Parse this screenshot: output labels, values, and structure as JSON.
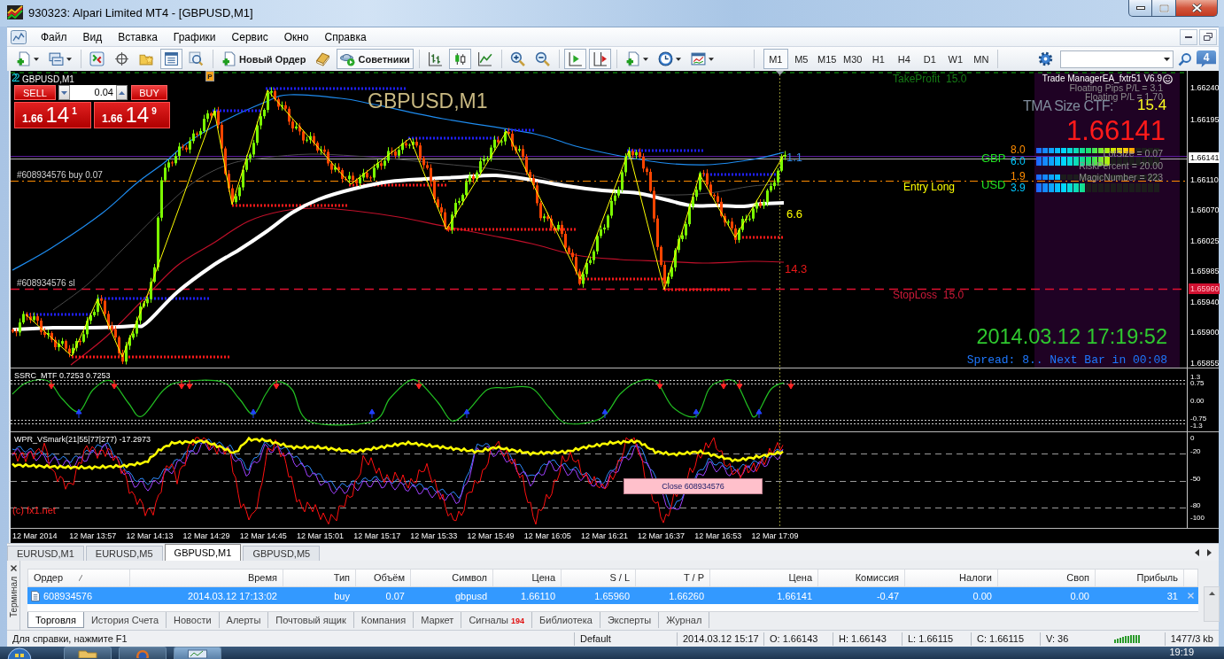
{
  "window": {
    "title": "930323: Alpari Limited MT4 - [GBPUSD,M1]"
  },
  "menu": [
    "Файл",
    "Вид",
    "Вставка",
    "Графики",
    "Сервис",
    "Окно",
    "Справка"
  ],
  "toolbar": {
    "groups": [
      [
        {
          "kind": "new-chart",
          "on": false
        },
        {
          "kind": "profiles",
          "on": false
        }
      ],
      [
        {
          "kind": "market-watch",
          "on": false
        },
        {
          "kind": "data-window",
          "on": false
        },
        {
          "kind": "navigator",
          "on": false
        },
        {
          "kind": "terminal",
          "on": true
        },
        {
          "kind": "tester",
          "on": false
        }
      ],
      [
        {
          "kind": "new-order",
          "label": "Новый Ордер",
          "on": false
        },
        {
          "kind": "editor",
          "on": false
        },
        {
          "kind": "experts",
          "label": "Советники",
          "on": true
        }
      ],
      [
        {
          "kind": "bar-chart",
          "on": false
        },
        {
          "kind": "candles",
          "on": true
        },
        {
          "kind": "line-chart",
          "on": false
        }
      ],
      [
        {
          "kind": "zoom-in",
          "on": false
        },
        {
          "kind": "zoom-out",
          "on": false
        }
      ],
      [
        {
          "kind": "autoscroll",
          "on": true
        },
        {
          "kind": "chart-shift",
          "on": true
        }
      ],
      [
        {
          "kind": "indicators",
          "on": false
        },
        {
          "kind": "periods",
          "on": false
        },
        {
          "kind": "templates",
          "on": false
        }
      ]
    ],
    "timeframes": [
      {
        "label": "M1",
        "selected": true
      },
      {
        "label": "M5",
        "selected": false
      },
      {
        "label": "M15",
        "selected": false
      },
      {
        "label": "M30",
        "selected": false
      },
      {
        "label": "H1",
        "selected": false
      },
      {
        "label": "H4",
        "selected": false
      },
      {
        "label": "D1",
        "selected": false
      },
      {
        "label": "W1",
        "selected": false
      },
      {
        "label": "MN",
        "selected": false
      }
    ],
    "messages": "4"
  },
  "chart": {
    "ea_mark": "22",
    "symbol": "GBPUSD,M1",
    "order_marker": "P",
    "one_click": {
      "sell": "SELL",
      "buy": "BUY",
      "lot": "0.04",
      "sell_price": {
        "big_figure": "1.66",
        "pips": "14",
        "point": "1"
      },
      "buy_price": {
        "big_figure": "1.66",
        "pips": "14",
        "point": "9"
      }
    },
    "overlay_title": "GBPUSD,M1",
    "order_lines": [
      "#608934576 buy 0.07",
      "#608934576 sl"
    ],
    "take_profit": "TakeProfit  15.0",
    "entry": "Entry Long",
    "stop_loss": "StopLoss  15.0",
    "distances": [
      {
        "text": "1.1",
        "color": "#3a8ee6"
      },
      {
        "text": "6.6",
        "color": "#ffff00"
      },
      {
        "text": "14.3",
        "color": "#e81818"
      }
    ],
    "ea_panel": {
      "title": "Trade ManagerEA_fxtr51 V6.9",
      "floating_pips": "Floating Pips P/L = 3.1",
      "floating_pl": "Floating P/L = 1.70",
      "tma_label": "TMA Size CTF:",
      "tma_value": "15.4",
      "price": "1.66141",
      "strength": [
        {
          "currency": "GBP",
          "readings": [
            {
              "text": "8.0",
              "level": 0.8,
              "color": "#ff8c00"
            },
            {
              "text": "6.0",
              "level": 0.6,
              "color": "#00c8ff"
            }
          ]
        },
        {
          "currency": "USD",
          "readings": [
            {
              "text": "1.9",
              "level": 0.19,
              "color": "#ff8c00"
            },
            {
              "text": "3.9",
              "level": 0.39,
              "color": "#00c8ff"
            }
          ]
        }
      ],
      "settings": [
        "LotSize = 0.07",
        "RiskPercent = 20.00",
        "MagicNumber = 223"
      ]
    },
    "clock": "2014.03.12 17:19:52",
    "spread": "Spread: 8.. Next Bar in 00:08",
    "price_axis": [
      {
        "text": "1.66240",
        "kind": "tick"
      },
      {
        "text": "1.66195",
        "kind": "tick"
      },
      {
        "text": "1.66141",
        "kind": "bid"
      },
      {
        "text": "1.66110",
        "kind": "tick"
      },
      {
        "text": "1.66070",
        "kind": "tick"
      },
      {
        "text": "1.66025",
        "kind": "tick"
      },
      {
        "text": "1.65985",
        "kind": "tick"
      },
      {
        "text": "1.65960",
        "kind": "stop"
      },
      {
        "text": "1.65940",
        "kind": "tick"
      },
      {
        "text": "1.65900",
        "kind": "tick"
      },
      {
        "text": "1.65855",
        "kind": "tick"
      }
    ]
  },
  "ssrc": {
    "label": "SSRC_MTF 0.7253 0.7253",
    "scale": [
      "1.3",
      "0.75",
      "0.00",
      "-0.75",
      "-1.3"
    ]
  },
  "wpr": {
    "label": "WPR_VSmark(21|55|77|277) -17.2973",
    "scale": [
      "0",
      "-20",
      "-50",
      "-80",
      "-100"
    ],
    "credit": "(c) fx1.net",
    "close_button": "Close 608934576"
  },
  "time_axis": [
    "12 Mar 2014",
    "12 Mar 13:57",
    "12 Mar 14:13",
    "12 Mar 14:29",
    "12 Mar 14:45",
    "12 Mar 15:01",
    "12 Mar 15:17",
    "12 Mar 15:33",
    "12 Mar 15:49",
    "12 Mar 16:05",
    "12 Mar 16:21",
    "12 Mar 16:37",
    "12 Mar 16:53",
    "12 Mar 17:09"
  ],
  "chart_tabs": [
    {
      "label": "EURUSD,M1",
      "selected": false
    },
    {
      "label": "EURUSD,M5",
      "selected": false
    },
    {
      "label": "GBPUSD,M1",
      "selected": true
    },
    {
      "label": "GBPUSD,M5",
      "selected": false
    }
  ],
  "terminal": {
    "side_label": "Терминал",
    "columns": [
      "Ордер",
      "Время",
      "Тип",
      "Объём",
      "Символ",
      "Цена",
      "S / L",
      "T / P",
      "Цена",
      "Комиссия",
      "Налоги",
      "Своп",
      "Прибыль"
    ],
    "rows": [
      {
        "selected": true,
        "cells": [
          "608934576",
          "2014.03.12 17:13:02",
          "buy",
          "0.07",
          "gbpusd",
          "1.66110",
          "1.65960",
          "1.66260",
          "1.66141",
          "-0.47",
          "0.00",
          "0.00",
          "31"
        ]
      }
    ],
    "tabs": [
      {
        "label": "Торговля",
        "selected": true
      },
      {
        "label": "История Счета",
        "selected": false
      },
      {
        "label": "Новости",
        "selected": false
      },
      {
        "label": "Алерты",
        "selected": false
      },
      {
        "label": "Почтовый ящик",
        "selected": false
      },
      {
        "label": "Компания",
        "selected": false
      },
      {
        "label": "Маркет",
        "selected": false
      },
      {
        "label": "Сигналы",
        "badge": "194",
        "selected": false
      },
      {
        "label": "Библиотека",
        "selected": false
      },
      {
        "label": "Эксперты",
        "selected": false
      },
      {
        "label": "Журнал",
        "selected": false
      }
    ]
  },
  "status_bar": {
    "help": "Для справки, нажмите F1",
    "profile": "Default",
    "bar_time": "2014.03.12 15:17",
    "ohlcv": [
      "O: 1.66143",
      "H: 1.66143",
      "L: 1.66115",
      "C: 1.66115",
      "V: 36"
    ],
    "traffic": "1477/3 kb"
  },
  "taskbar": {
    "clock": "19:19"
  }
}
